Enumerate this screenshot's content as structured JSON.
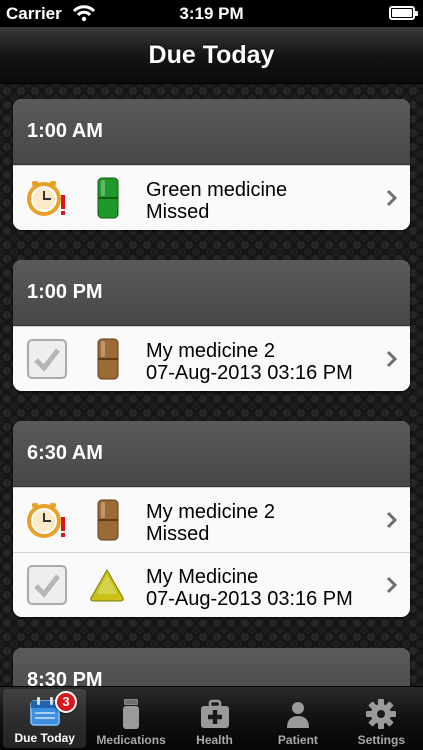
{
  "status_bar": {
    "carrier": "Carrier",
    "time": "3:19 PM"
  },
  "nav": {
    "title": "Due Today"
  },
  "groups": [
    {
      "time": "1:00 AM",
      "rows": [
        {
          "status": "clock-missed-icon",
          "pill_color": "#1f9a2a",
          "name": "Green medicine",
          "detail": "Missed"
        }
      ]
    },
    {
      "time": "1:00 PM",
      "rows": [
        {
          "status": "checkbox-icon",
          "pill_color": "#9c6a34",
          "name": "My medicine 2",
          "detail": "07-Aug-2013 03:16 PM"
        }
      ]
    },
    {
      "time": "6:30 AM",
      "rows": [
        {
          "status": "clock-missed-icon",
          "pill_color": "#9c6a34",
          "name": "My medicine 2",
          "detail": "Missed"
        },
        {
          "status": "checkbox-icon",
          "pill_color": "#c9c214",
          "pill_shape": "triangle",
          "name": "My Medicine",
          "detail": "07-Aug-2013 03:16 PM"
        }
      ]
    },
    {
      "time": "8:30 PM",
      "rows": []
    }
  ],
  "tabs": [
    {
      "label": "Due Today",
      "icon": "calendar-icon",
      "active": true,
      "badge": "3"
    },
    {
      "label": "Medications",
      "icon": "pill-bottle-icon",
      "active": false
    },
    {
      "label": "Health",
      "icon": "medical-kit-icon",
      "active": false
    },
    {
      "label": "Patient",
      "icon": "person-icon",
      "active": false
    },
    {
      "label": "Settings",
      "icon": "gear-icon",
      "active": false
    }
  ],
  "colors": {
    "badge": "#d8161c",
    "header": "#4f4f4f",
    "alarm": "#e8a028"
  }
}
